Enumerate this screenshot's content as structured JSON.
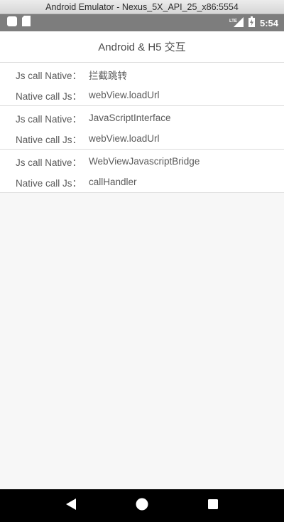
{
  "window": {
    "title": "Android Emulator - Nexus_5X_API_25_x86:5554"
  },
  "status_bar": {
    "time": "5:54",
    "network_label": "LTE"
  },
  "app": {
    "title": "Android & H5 交互"
  },
  "sections": [
    {
      "rows": [
        {
          "label": "Js call Native：",
          "value": "拦截跳转"
        },
        {
          "label": "Native call Js：",
          "value": "webView.loadUrl"
        }
      ]
    },
    {
      "rows": [
        {
          "label": "Js call Native：",
          "value": "JavaScriptInterface"
        },
        {
          "label": "Native call Js：",
          "value": "webView.loadUrl"
        }
      ]
    },
    {
      "rows": [
        {
          "label": "Js call Native：",
          "value": "WebViewJavascriptBridge"
        },
        {
          "label": "Native call Js：",
          "value": "callHandler"
        }
      ]
    }
  ],
  "nav_icons": [
    "back-icon",
    "home-icon",
    "recents-icon"
  ]
}
